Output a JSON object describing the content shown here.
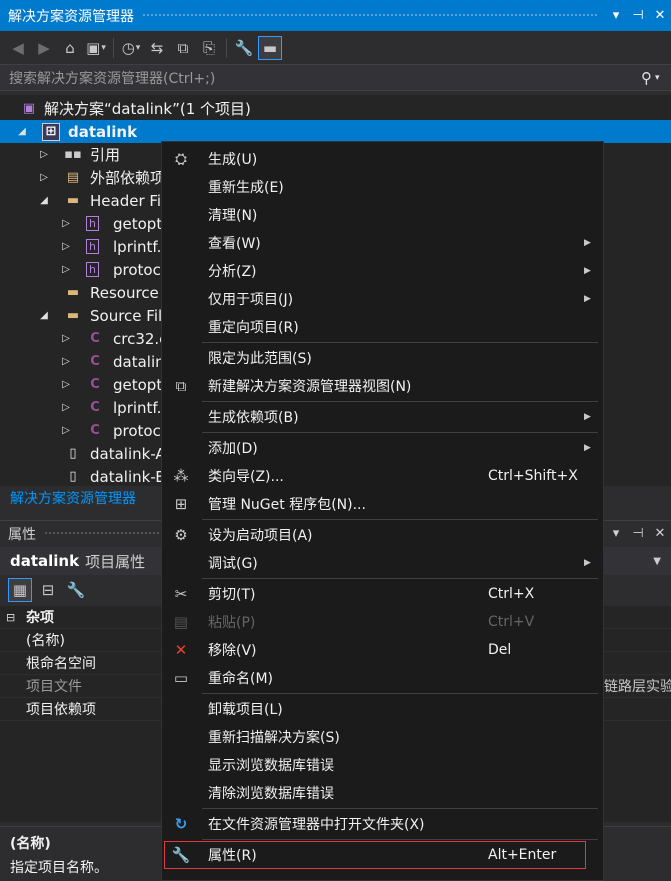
{
  "solution_explorer": {
    "title": "解决方案资源管理器",
    "search_placeholder": "搜索解决方案资源管理器(Ctrl+;)",
    "tab_label": "解决方案资源管理器",
    "tree": [
      {
        "label": "解决方案“datalink”(1 个项目)",
        "icon": "solution-icon"
      },
      {
        "label": "datalink",
        "icon": "project-icon",
        "selected": true
      },
      {
        "label": "引用",
        "icon": "references-icon"
      },
      {
        "label": "外部依赖项",
        "icon": "external-deps-icon"
      },
      {
        "label": "Header Fi",
        "icon": "folder-icon"
      },
      {
        "label": "getopt",
        "icon": "header-file-icon"
      },
      {
        "label": "lprintf.",
        "icon": "header-file-icon"
      },
      {
        "label": "protoc",
        "icon": "header-file-icon"
      },
      {
        "label": "Resource",
        "icon": "folder-icon"
      },
      {
        "label": "Source Fil",
        "icon": "folder-icon"
      },
      {
        "label": "crc32.c",
        "icon": "c-file-icon"
      },
      {
        "label": "datalin",
        "icon": "c-file-icon"
      },
      {
        "label": "getopt",
        "icon": "c-file-icon"
      },
      {
        "label": "lprintf.",
        "icon": "c-file-icon"
      },
      {
        "label": "protoc",
        "icon": "c-file-icon"
      },
      {
        "label": "datalink-A",
        "icon": "file-icon"
      },
      {
        "label": "datalink-B",
        "icon": "file-icon"
      }
    ]
  },
  "properties": {
    "title": "属性",
    "object_name": "datalink",
    "object_suffix": "项目属性",
    "rows": [
      {
        "key": "杂项",
        "value": ""
      },
      {
        "key": "(名称)",
        "value": ""
      },
      {
        "key": "根命名空间",
        "value": ""
      },
      {
        "key": "项目文件",
        "value": "链路层实验"
      },
      {
        "key": "项目依赖项",
        "value": ""
      }
    ],
    "description_name": "(名称)",
    "description_text": "指定项目名称。"
  },
  "context_menu": {
    "items": [
      {
        "label": "生成(U)",
        "shortcut": "",
        "icon": "build-icon"
      },
      {
        "label": "重新生成(E)",
        "shortcut": ""
      },
      {
        "label": "清理(N)",
        "shortcut": ""
      },
      {
        "label": "查看(W)",
        "shortcut": "",
        "submenu": true
      },
      {
        "label": "分析(Z)",
        "shortcut": "",
        "submenu": true
      },
      {
        "label": "仅用于项目(J)",
        "shortcut": "",
        "submenu": true
      },
      {
        "label": "重定向项目(R)",
        "shortcut": ""
      },
      {
        "label": "限定为此范围(S)",
        "shortcut": ""
      },
      {
        "label": "新建解决方案资源管理器视图(N)",
        "shortcut": "",
        "icon": "new-view-icon"
      },
      {
        "label": "生成依赖项(B)",
        "shortcut": "",
        "submenu": true
      },
      {
        "label": "添加(D)",
        "shortcut": "",
        "submenu": true
      },
      {
        "label": "类向导(Z)...",
        "shortcut": "Ctrl+Shift+X",
        "icon": "class-wizard-icon"
      },
      {
        "label": "管理 NuGet 程序包(N)...",
        "shortcut": "",
        "icon": "nuget-icon"
      },
      {
        "label": "设为启动项目(A)",
        "shortcut": "",
        "icon": "gear-icon"
      },
      {
        "label": "调试(G)",
        "shortcut": "",
        "submenu": true
      },
      {
        "label": "剪切(T)",
        "shortcut": "Ctrl+X",
        "icon": "scissors-icon"
      },
      {
        "label": "粘贴(P)",
        "shortcut": "Ctrl+V",
        "icon": "paste-icon",
        "disabled": true
      },
      {
        "label": "移除(V)",
        "shortcut": "Del",
        "icon": "remove-icon"
      },
      {
        "label": "重命名(M)",
        "shortcut": "",
        "icon": "rename-icon"
      },
      {
        "label": "卸载项目(L)",
        "shortcut": ""
      },
      {
        "label": "重新扫描解决方案(S)",
        "shortcut": ""
      },
      {
        "label": "显示浏览数据库错误",
        "shortcut": ""
      },
      {
        "label": "清除浏览数据库错误",
        "shortcut": ""
      },
      {
        "label": "在文件资源管理器中打开文件夹(X)",
        "shortcut": "",
        "icon": "refresh-arrow-icon"
      },
      {
        "label": "属性(R)",
        "shortcut": "Alt+Enter",
        "icon": "wrench-icon",
        "highlighted": true
      }
    ]
  },
  "colors": {
    "accent": "#007acc",
    "background": "#2d2d30",
    "menu_background": "#1b1b1c",
    "highlight_border": "#e0393e",
    "c_file": "#9b4f96"
  }
}
